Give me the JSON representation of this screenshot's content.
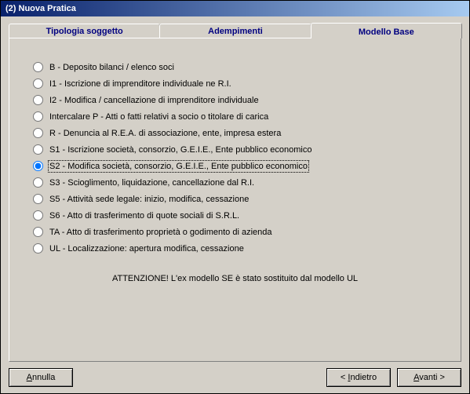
{
  "window": {
    "title": "(2) Nuova Pratica"
  },
  "tabs": [
    {
      "label": "Tipologia soggetto"
    },
    {
      "label": "Adempimenti"
    },
    {
      "label": "Modello Base"
    }
  ],
  "options": [
    {
      "label": "B - Deposito bilanci / elenco soci",
      "selected": false
    },
    {
      "label": "I1 - Iscrizione di imprenditore individuale ne R.I.",
      "selected": false
    },
    {
      "label": "I2 - Modifica / cancellazione di imprenditore individuale",
      "selected": false
    },
    {
      "label": "Intercalare P - Atti o fatti relativi a socio o titolare di carica",
      "selected": false
    },
    {
      "label": "R - Denuncia al R.E.A. di associazione, ente, impresa estera",
      "selected": false
    },
    {
      "label": "S1 - Iscrizione società, consorzio, G.E.I.E., Ente pubblico economico",
      "selected": false
    },
    {
      "label": "S2 - Modifica società, consorzio, G.E.I.E., Ente pubblico economico",
      "selected": true
    },
    {
      "label": "S3 - Scioglimento, liquidazione, cancellazione dal R.I.",
      "selected": false
    },
    {
      "label": "S5 - Attività sede legale: inizio, modifica, cessazione",
      "selected": false
    },
    {
      "label": "S6 - Atto di trasferimento di quote sociali di S.R.L.",
      "selected": false
    },
    {
      "label": "TA - Atto di trasferimento proprietà o godimento di azienda",
      "selected": false
    },
    {
      "label": "UL - Localizzazione: apertura modifica, cessazione",
      "selected": false
    }
  ],
  "warning": "ATTENZIONE! L'ex modello SE è stato sostituito dal modello UL",
  "buttons": {
    "cancel_a": "A",
    "cancel_rest": "nnulla",
    "back_pre": "< ",
    "back_i": "I",
    "back_rest": "ndietro",
    "next_a": "A",
    "next_rest": "vanti >"
  }
}
